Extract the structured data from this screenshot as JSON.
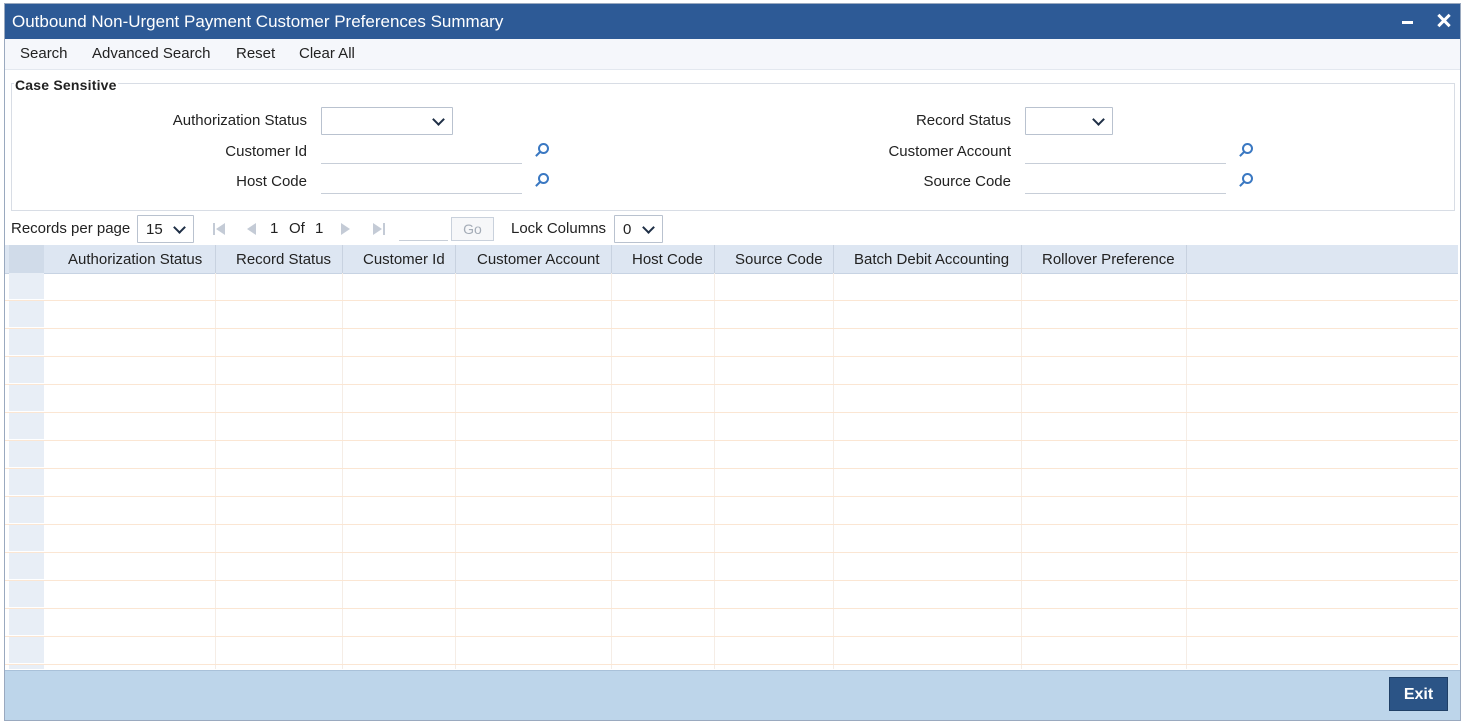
{
  "window": {
    "title": "Outbound Non-Urgent Payment Customer Preferences Summary"
  },
  "toolbar": {
    "search": "Search",
    "advanced_search": "Advanced Search",
    "reset": "Reset",
    "clear_all": "Clear All"
  },
  "criteria": {
    "legend": "Case Sensitive",
    "authorization_status": {
      "label": "Authorization Status",
      "value": ""
    },
    "record_status": {
      "label": "Record Status",
      "value": ""
    },
    "customer_id": {
      "label": "Customer Id",
      "value": ""
    },
    "customer_account": {
      "label": "Customer Account",
      "value": ""
    },
    "host_code": {
      "label": "Host Code",
      "value": ""
    },
    "source_code": {
      "label": "Source Code",
      "value": ""
    }
  },
  "pager": {
    "records_per_page_label": "Records per page",
    "records_per_page": "15",
    "current_page": "1",
    "of_label": "Of",
    "total_pages": "1",
    "go": "Go",
    "lock_columns_label": "Lock Columns",
    "lock_columns": "0"
  },
  "grid": {
    "columns": [
      "Authorization Status",
      "Record Status",
      "Customer Id",
      "Customer Account",
      "Host Code",
      "Source Code",
      "Batch Debit Accounting",
      "Rollover Preference"
    ],
    "rows": []
  },
  "footer": {
    "exit": "Exit"
  },
  "colors": {
    "title_bar": "#2d5a96",
    "footer": "#bdd5ea",
    "exit_button": "#2b5486",
    "header_row": "#dde6f2"
  }
}
